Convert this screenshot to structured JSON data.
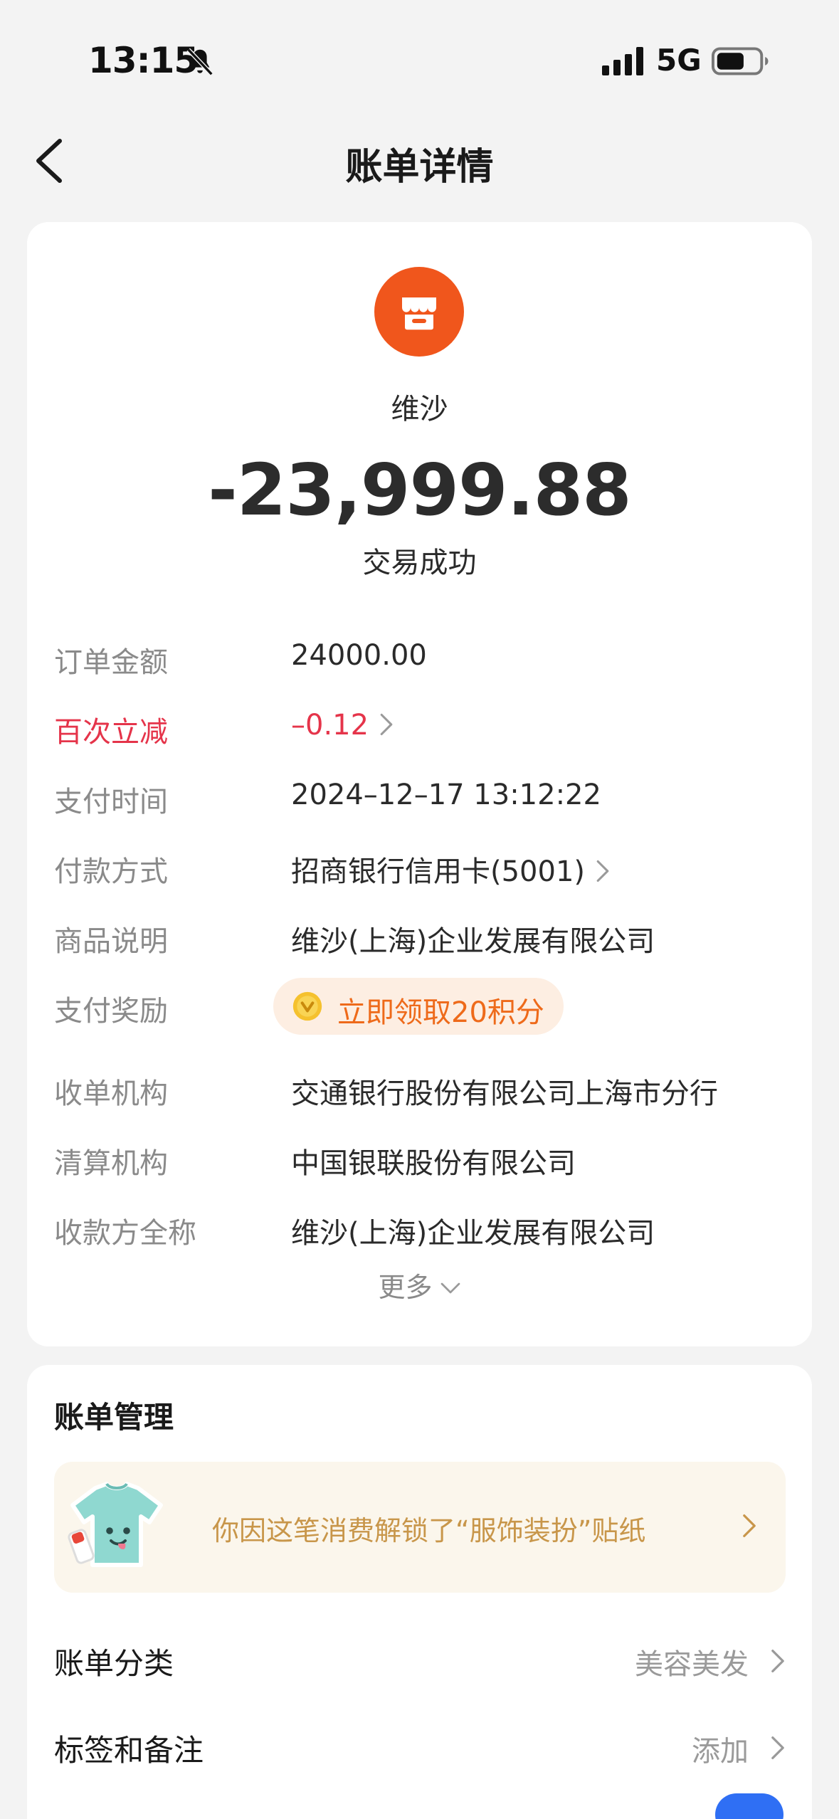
{
  "status_bar": {
    "time": "13:15",
    "network": "5G",
    "icons": [
      "bell-off-icon",
      "signal-icon",
      "battery-icon"
    ]
  },
  "nav": {
    "title": "账单详情",
    "back_icon": "chevron-left-icon"
  },
  "merchant": {
    "name": "维沙",
    "amount": "-23,999.88",
    "status": "交易成功",
    "logo_icon": "store-icon",
    "logo_color": "#f0561c"
  },
  "details": {
    "order_amount": {
      "label": "订单金额",
      "value": "24000.00"
    },
    "discount": {
      "label": "百次立减",
      "value": "–0.12",
      "color": "#e5344a"
    },
    "pay_time": {
      "label": "支付时间",
      "value": "2024–12–17 13:12:22"
    },
    "pay_method": {
      "label": "付款方式",
      "value": "招商银行信用卡(5001)"
    },
    "item_desc": {
      "label": "商品说明",
      "value": "维沙(上海)企业发展有限公司"
    },
    "reward": {
      "label": "支付奖励",
      "value": "立即领取20积分",
      "color": "#ee6a1a"
    },
    "acquirer": {
      "label": "收单机构",
      "value": "交通银行股份有限公司上海市分行"
    },
    "clearing": {
      "label": "清算机构",
      "value": "中国银联股份有限公司"
    },
    "payee": {
      "label": "收款方全称",
      "value": "维沙(上海)企业发展有限公司"
    },
    "more_label": "更多"
  },
  "manage": {
    "title": "账单管理",
    "sticker_text": "你因这笔消费解锁了“服饰装扮”贴纸",
    "category": {
      "label": "账单分类",
      "value": "美容美发"
    },
    "tags": {
      "label": "标签和备注",
      "value": "添加"
    },
    "toggle_on": true,
    "accent": "#2f6ff4"
  }
}
